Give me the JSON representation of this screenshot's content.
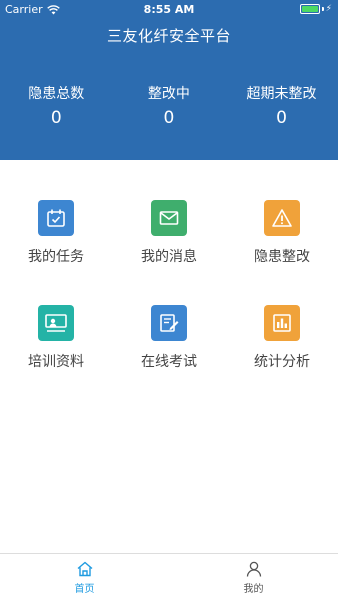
{
  "status_bar": {
    "carrier": "Carrier",
    "time": "8:55 AM"
  },
  "app_title": "三友化纤安全平台",
  "stats": [
    {
      "label": "隐患总数",
      "value": "0"
    },
    {
      "label": "整改中",
      "value": "0"
    },
    {
      "label": "超期未整改",
      "value": "0"
    }
  ],
  "menu": [
    {
      "label": "我的任务",
      "icon": "calendar-check-icon",
      "color": "#3d86d1"
    },
    {
      "label": "我的消息",
      "icon": "envelope-icon",
      "color": "#3fae6d"
    },
    {
      "label": "隐患整改",
      "icon": "warning-icon",
      "color": "#f0a23a"
    },
    {
      "label": "培训资料",
      "icon": "presentation-icon",
      "color": "#24b3a6"
    },
    {
      "label": "在线考试",
      "icon": "edit-note-icon",
      "color": "#3d86d1"
    },
    {
      "label": "统计分析",
      "icon": "bar-chart-icon",
      "color": "#f0a23a"
    }
  ],
  "tabbar": {
    "home": {
      "label": "首页",
      "color": "#1f9be0",
      "icon": "home-icon"
    },
    "mine": {
      "label": "我的",
      "color": "#555555",
      "icon": "user-icon"
    }
  },
  "colors": {
    "header": "#2c6cb0",
    "battery": "#4cd964"
  }
}
